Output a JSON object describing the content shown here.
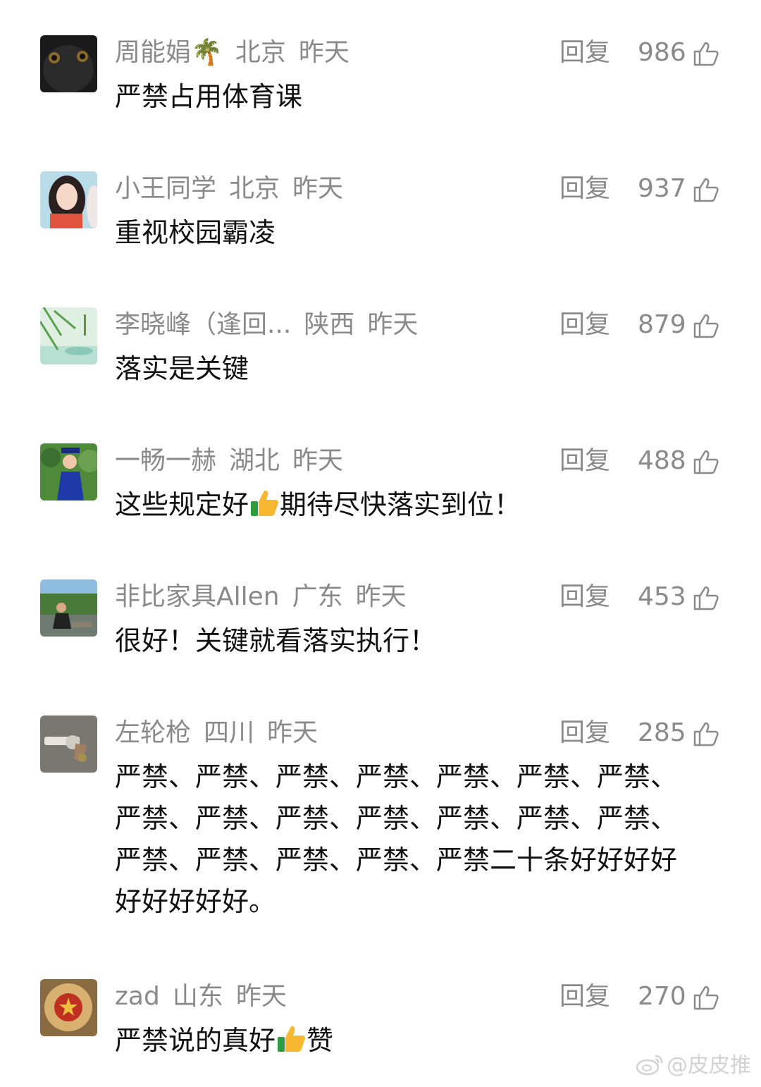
{
  "comments": [
    {
      "username": "周能娟🌴",
      "location": "北京",
      "time": "昨天",
      "reply_label": "回复",
      "likes": "986",
      "text": "严禁占用体育课"
    },
    {
      "username": "小王同学",
      "location": "北京",
      "time": "昨天",
      "reply_label": "回复",
      "likes": "937",
      "text": "重视校园霸凌"
    },
    {
      "username": "李晓峰（逢回...",
      "location": "陕西",
      "time": "昨天",
      "reply_label": "回复",
      "likes": "879",
      "text": "落实是关键"
    },
    {
      "username": "一畅一赫",
      "location": "湖北",
      "time": "昨天",
      "reply_label": "回复",
      "likes": "488",
      "text_before": "这些规定好",
      "text_after": "期待尽快落实到位！"
    },
    {
      "username": "非比家具Allen",
      "location": "广东",
      "time": "昨天",
      "reply_label": "回复",
      "likes": "453",
      "text": "很好！关键就看落实执行！"
    },
    {
      "username": "左轮枪",
      "location": "四川",
      "time": "昨天",
      "reply_label": "回复",
      "likes": "285",
      "text_lines": [
        "严禁、严禁、严禁、严禁、严禁、严禁、严禁、",
        "严禁、严禁、严禁、严禁、严禁、严禁、严禁、",
        "严禁、严禁、严禁、严禁、严禁二十条好好好好",
        "好好好好好。"
      ]
    },
    {
      "username": "zad",
      "location": "山东",
      "time": "昨天",
      "reply_label": "回复",
      "likes": "270",
      "text_before": "严禁说的真好",
      "text_after": "赞"
    }
  ],
  "watermark": "@皮皮推",
  "icons": {
    "like": "thumbs-up-outline-icon",
    "emoji": "thumbs-up-emoji-icon",
    "watermark": "weibo-logo-icon"
  }
}
